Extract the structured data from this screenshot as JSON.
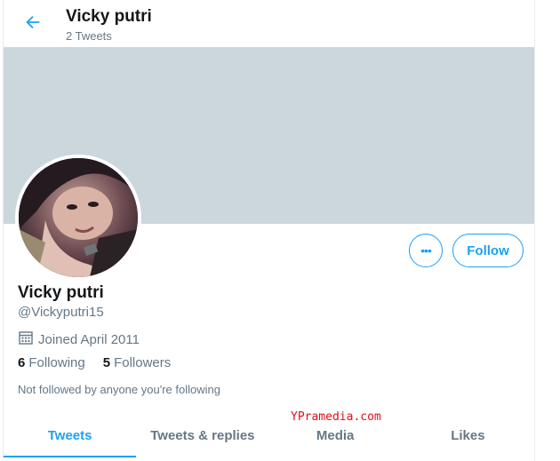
{
  "header": {
    "title": "Vicky putri",
    "tweet_count": "2 Tweets"
  },
  "profile": {
    "name": "Vicky putri",
    "handle": "@Vickyputri15",
    "joined": "Joined April 2011",
    "following_count": "6",
    "following_label": "Following",
    "followers_count": "5",
    "followers_label": "Followers",
    "not_followed": "Not followed by anyone you're following"
  },
  "actions": {
    "more_label": "•••",
    "follow_label": "Follow"
  },
  "watermark": "YPramedia.com",
  "tabs": [
    {
      "label": "Tweets",
      "active": true
    },
    {
      "label": "Tweets & replies",
      "active": false
    },
    {
      "label": "Media",
      "active": false
    },
    {
      "label": "Likes",
      "active": false
    }
  ],
  "colors": {
    "accent": "#1da1f2",
    "banner": "#ccd6dd",
    "secondary_text": "#657786",
    "watermark": "#e0101a"
  },
  "icons": {
    "back": "arrow-left-icon",
    "calendar": "calendar-icon"
  }
}
